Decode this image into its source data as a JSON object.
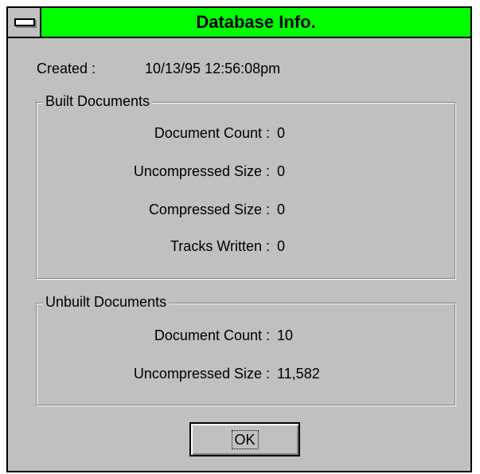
{
  "window": {
    "title": "Database Info."
  },
  "created": {
    "label": "Created :",
    "value": "10/13/95 12:56:08pm"
  },
  "built_documents": {
    "title": "Built Documents",
    "rows": [
      {
        "label": "Document Count :",
        "value": "0"
      },
      {
        "label": "Uncompressed Size :",
        "value": "0"
      },
      {
        "label": "Compressed Size :",
        "value": "0"
      },
      {
        "label": "Tracks Written :",
        "value": "0"
      }
    ]
  },
  "unbuilt_documents": {
    "title": "Unbuilt Documents",
    "rows": [
      {
        "label": "Document Count :",
        "value": "10"
      },
      {
        "label": "Uncompressed Size :",
        "value": "11,582"
      }
    ]
  },
  "buttons": {
    "ok_label": "OK"
  },
  "colors": {
    "titlebar": "#00ff00",
    "dialog_face": "#c0c0c0"
  },
  "icons": {
    "system_menu": "system-menu-icon"
  }
}
